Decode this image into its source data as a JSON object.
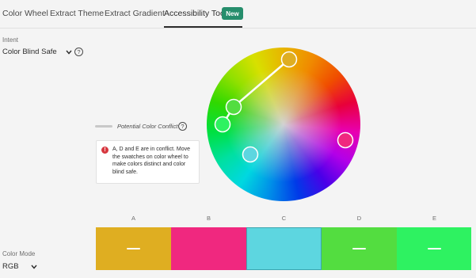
{
  "tabs": [
    {
      "label": "Color Wheel"
    },
    {
      "label": "Extract Theme"
    },
    {
      "label": "Extract Gradient"
    },
    {
      "label": "Accessibility Tools",
      "active": true
    }
  ],
  "new_badge": "New",
  "intent": {
    "label": "Intent",
    "value": "Color Blind Safe",
    "help": "?"
  },
  "conflict_legend": {
    "label": "Potential Color Conflict",
    "help": "?"
  },
  "alert": {
    "icon": "!",
    "text": "A, D and E are in conflict. Move the swatches on color wheel to make colors distinct and color blind safe."
  },
  "swatches": [
    {
      "letter": "A",
      "color": "#dfae21",
      "marked": true
    },
    {
      "letter": "B",
      "color": "#f0287f",
      "marked": false
    },
    {
      "letter": "C",
      "color": "#5dd6e0",
      "marked": false
    },
    {
      "letter": "D",
      "color": "#53dd40",
      "marked": true
    },
    {
      "letter": "E",
      "color": "#2ef261",
      "marked": true
    }
  ],
  "color_mode": {
    "label": "Color Mode",
    "value": "RGB"
  },
  "colors": {
    "badge": "#268e6c",
    "alert_icon": "#d7373f",
    "conflict_line": "#ffffff"
  }
}
